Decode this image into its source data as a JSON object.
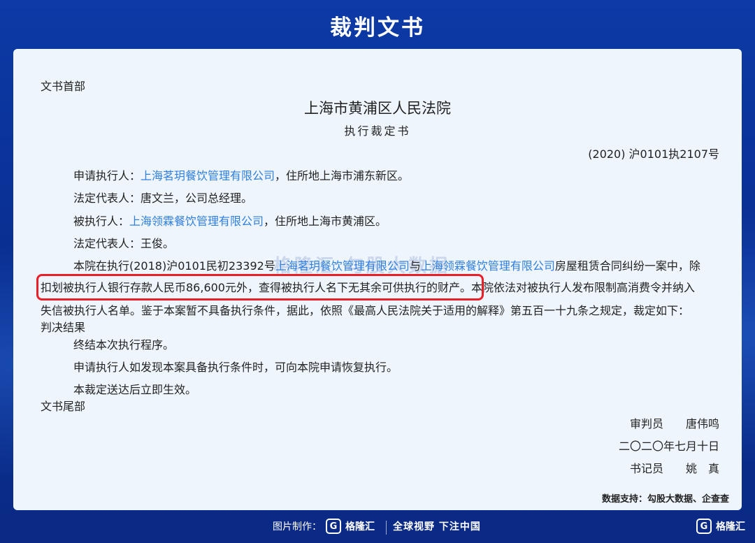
{
  "page_title": "裁判文书",
  "doc": {
    "header_label": "文书首部",
    "court": "上海市黄浦区人民法院",
    "doc_type": "执行裁定书",
    "case_number": "(2020) 沪0101执2107号",
    "applicant_prefix": "申请执行人：",
    "applicant_name": "上海茗玥餐饮管理有限公司",
    "applicant_suffix": "，住所地上海市浦东新区。",
    "applicant_rep": "法定代表人：唐文兰，公司总经理。",
    "respondent_prefix": "被执行人：",
    "respondent_name": "上海领霖餐饮管理有限公司",
    "respondent_suffix": "，住所地上海市黄浦区。",
    "respondent_rep": "法定代表人：王俊。",
    "body_line1_a": "本院在执行(2018)沪0101民初23392号",
    "body_line1_b": "上海茗玥餐饮管理有限公司",
    "body_line1_c": "与",
    "body_line1_d": "上海领霖餐饮管理有限公司",
    "body_line1_e": "房屋租赁合同纠纷一案中，除",
    "body_line2_highlight": "扣划被执行人银行存款人民币86,600元外，查得被执行人名下无其余可供执行的财产",
    "body_line2_rest": "。本院依法对被执行人发布限制高消费令并纳入",
    "body_line3": "失信被执行人名单。鉴于本案暂不具备执行条件，据此，依照《最高人民法院关于适用的解释》第五百一十九条之规定，裁定如下：",
    "result_label": "判决结果",
    "ruling1": "终结本次执行程序。",
    "ruling2": "申请执行人如发现本案具备执行条件时，可向本院申请恢复执行。",
    "ruling3": "本裁定送达后立即生效。",
    "footer_label": "文书尾部",
    "judge": "审判员　　唐伟鸣",
    "date": "二〇二〇年七月十日",
    "clerk": "书记员　　姚　真",
    "data_source": "数据支持：勾股大数据、企查查",
    "watermark": "格隆汇  勾股大数据"
  },
  "footer": {
    "credit_label": "图片制作：",
    "brand": "格隆汇",
    "slogan": "全球视野 下注中国",
    "corner_brand": "格隆汇"
  },
  "colors": {
    "accent_blue": "#2f7fe0",
    "highlight_red": "#e8202a",
    "background": "#0a2f93"
  }
}
